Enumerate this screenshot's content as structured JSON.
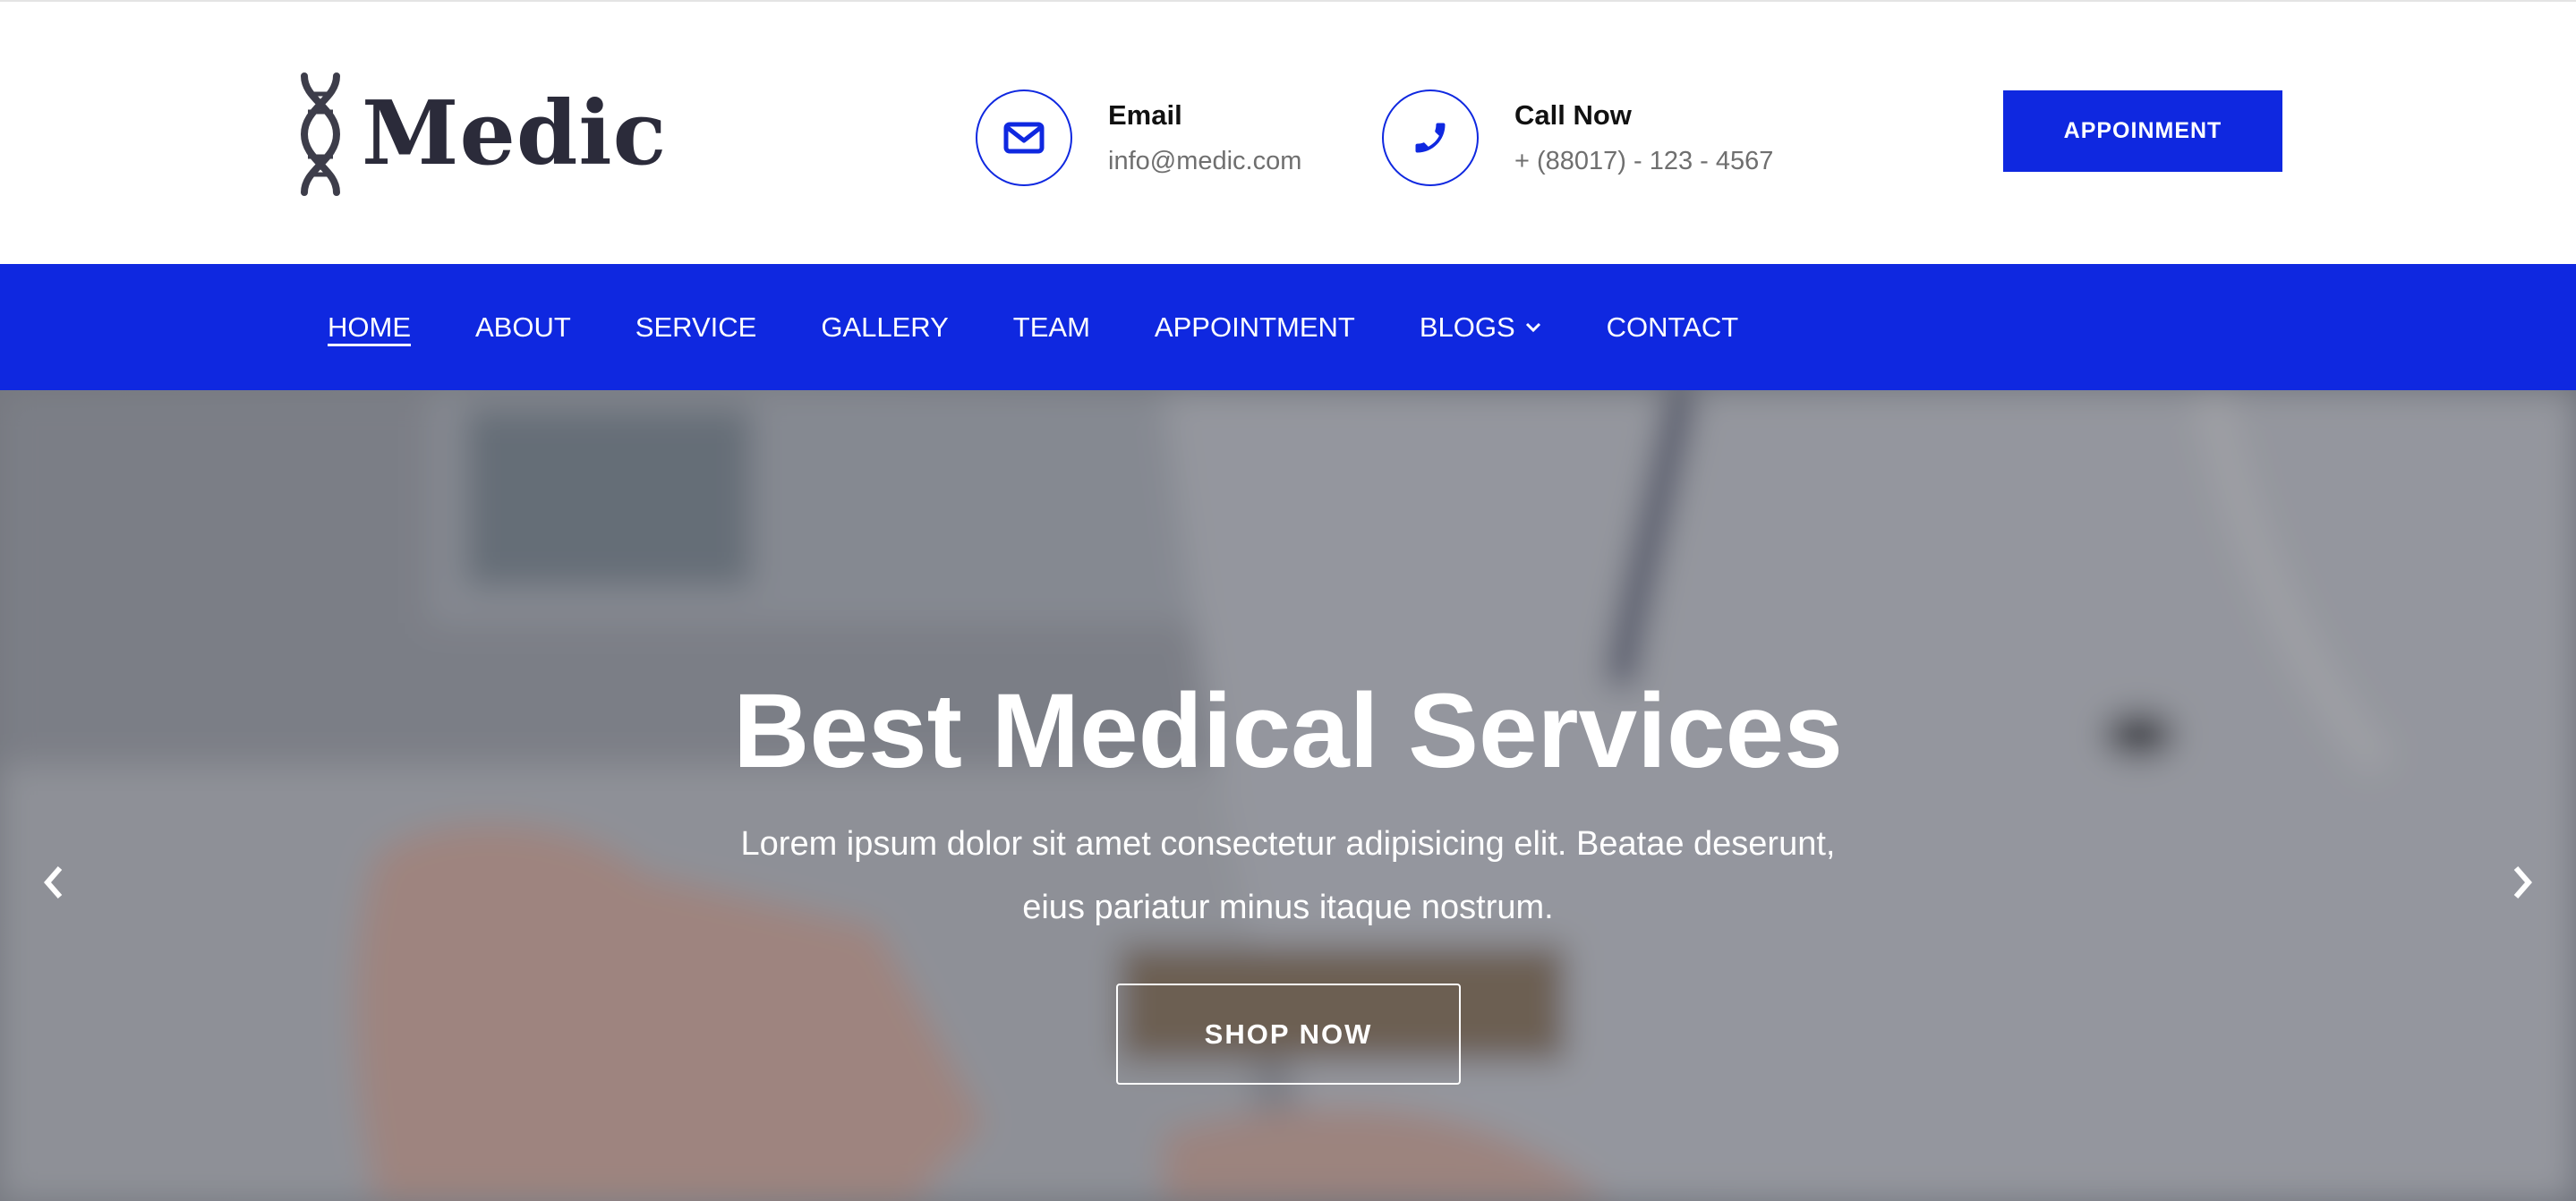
{
  "brand": {
    "name": "Medic",
    "logo_icon": "dna-icon",
    "text_color": "#2b2b3a"
  },
  "contacts": [
    {
      "icon": "envelope-icon",
      "title": "Email",
      "value": "info@medic.com"
    },
    {
      "icon": "phone-icon",
      "title": "Call Now",
      "value": "+ (88017) - 123 - 4567"
    }
  ],
  "header": {
    "appointment_button": "APPOINMENT"
  },
  "nav": {
    "items": [
      {
        "label": "HOME",
        "active": true
      },
      {
        "label": "ABOUT"
      },
      {
        "label": "SERVICE"
      },
      {
        "label": "GALLERY"
      },
      {
        "label": "TEAM"
      },
      {
        "label": "APPOINTMENT"
      },
      {
        "label": "BLOGS",
        "dropdown": true
      },
      {
        "label": "CONTACT"
      }
    ]
  },
  "hero": {
    "title": "Best Medical Services",
    "subtitle_line1": "Lorem ipsum dolor sit amet consectetur adipisicing elit. Beatae deserunt,",
    "subtitle_line2": "eius pariatur minus itaque nostrum.",
    "cta": "SHOP NOW",
    "prev_icon": "chevron-left-icon",
    "next_icon": "chevron-right-icon"
  },
  "colors": {
    "primary": "#0f28e0",
    "white": "#ffffff",
    "muted_text": "#6f6f6f",
    "heading_text": "#111111"
  }
}
